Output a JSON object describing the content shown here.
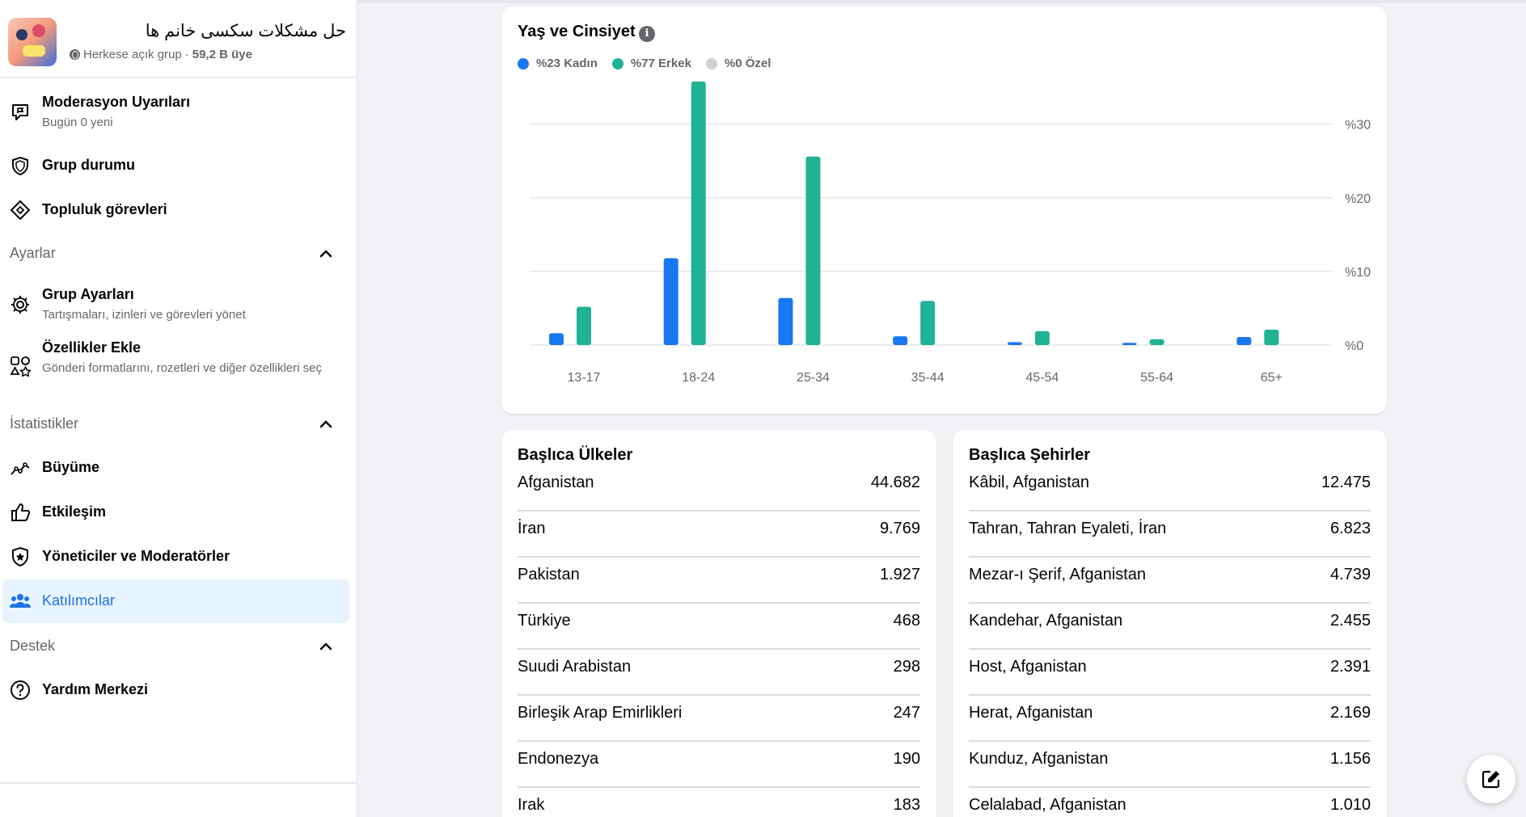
{
  "group": {
    "name": "حل مشکلات سکسی خانم ها",
    "privacy": "Herkese açık grup",
    "separator": "·",
    "members": "59,2 B üye"
  },
  "sidebar": {
    "items_top": [
      {
        "title": "Moderasyon Uyarıları",
        "sub": "Bugün 0 yeni",
        "icon": "flag-bubble-icon"
      },
      {
        "title": "Grup durumu",
        "icon": "shield-icon"
      },
      {
        "title": "Topluluk görevleri",
        "icon": "diamond-icon"
      }
    ],
    "settings_head": "Ayarlar",
    "settings_items": [
      {
        "title": "Grup Ayarları",
        "sub": "Tartışmaları, izinleri ve görevleri yönet",
        "icon": "gear-icon"
      },
      {
        "title": "Özellikler Ekle",
        "sub": "Gönderi formatlarını, rozetleri ve diğer özellikleri seç",
        "icon": "shapes-icon"
      }
    ],
    "stats_head": "İstatistikler",
    "stats_items": [
      {
        "title": "Büyüme",
        "icon": "growth-chart-icon"
      },
      {
        "title": "Etkileşim",
        "icon": "thumbs-up-icon"
      },
      {
        "title": "Yöneticiler ve Moderatörler",
        "icon": "star-shield-icon"
      },
      {
        "title": "Katılımcılar",
        "icon": "people-icon",
        "active": true
      }
    ],
    "support_head": "Destek",
    "support_items": [
      {
        "title": "Yardım Merkezi",
        "icon": "question-circle-icon"
      }
    ]
  },
  "age_gender": {
    "title": "Yaş ve Cinsiyet",
    "legend": [
      {
        "label": "%23 Kadın",
        "color": "#1877f2"
      },
      {
        "label": "%77 Erkek",
        "color": "#1fb295"
      },
      {
        "label": "%0 Özel",
        "color": "#ced0d4"
      }
    ]
  },
  "chart_data": {
    "type": "bar",
    "title": "Yaş ve Cinsiyet",
    "categories": [
      "13-17",
      "18-24",
      "25-34",
      "35-44",
      "45-54",
      "55-64",
      "65+"
    ],
    "series": [
      {
        "name": "%23 Kadın",
        "color": "#1877f2",
        "values": [
          1.6,
          11.8,
          6.4,
          1.2,
          0.4,
          0.3,
          1.1
        ]
      },
      {
        "name": "%77 Erkek",
        "color": "#1fb295",
        "values": [
          5.2,
          35.8,
          25.6,
          6.0,
          1.9,
          0.8,
          2.1
        ]
      }
    ],
    "y_ticks": [
      "%0",
      "%10",
      "%20",
      "%30"
    ],
    "y_tick_values": [
      0,
      10,
      20,
      30
    ],
    "ylim": [
      0,
      36
    ],
    "axis_side": "right",
    "grid": true
  },
  "countries": {
    "title": "Başlıca Ülkeler",
    "rows": [
      {
        "name": "Afganistan",
        "value": "44.682"
      },
      {
        "name": "İran",
        "value": "9.769"
      },
      {
        "name": "Pakistan",
        "value": "1.927"
      },
      {
        "name": "Türkiye",
        "value": "468"
      },
      {
        "name": "Suudi Arabistan",
        "value": "298"
      },
      {
        "name": "Birleşik Arap Emirlikleri",
        "value": "247"
      },
      {
        "name": "Endonezya",
        "value": "190"
      },
      {
        "name": "Irak",
        "value": "183"
      }
    ]
  },
  "cities": {
    "title": "Başlıca Şehirler",
    "rows": [
      {
        "name": "Kâbil, Afganistan",
        "value": "12.475"
      },
      {
        "name": "Tahran, Tahran Eyaleti, İran",
        "value": "6.823"
      },
      {
        "name": "Mezar-ı Şerif, Afganistan",
        "value": "4.739"
      },
      {
        "name": "Kandehar, Afganistan",
        "value": "2.455"
      },
      {
        "name": "Host, Afganistan",
        "value": "2.391"
      },
      {
        "name": "Herat, Afganistan",
        "value": "2.169"
      },
      {
        "name": "Kunduz, Afganistan",
        "value": "1.156"
      },
      {
        "name": "Celalabad, Afganistan",
        "value": "1.010"
      }
    ]
  }
}
